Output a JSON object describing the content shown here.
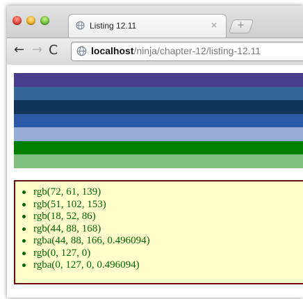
{
  "window": {
    "tab": {
      "title": "Listing 12.11",
      "close_glyph": "×"
    },
    "new_tab_glyph": "+",
    "toolbar": {
      "back_glyph": "←",
      "forward_glyph": "→",
      "reload_glyph": "C",
      "url_host": "localhost",
      "url_path": "/ninja/chapter-12/listing-12.11"
    }
  },
  "stripes": [
    {
      "color": "rgb(72, 61, 139)"
    },
    {
      "color": "rgb(51, 102, 153)"
    },
    {
      "color": "rgb(18, 52, 86)"
    },
    {
      "color": "rgb(44, 88, 168)"
    },
    {
      "color": "rgba(44, 88, 166, 0.496094)"
    },
    {
      "color": "rgb(0, 127, 0)"
    },
    {
      "color": "rgba(0, 127, 0, 0.496094)"
    }
  ],
  "color_list": [
    "rgb(72, 61, 139)",
    "rgb(51, 102, 153)",
    "rgb(18, 52, 86)",
    "rgb(44, 88, 168)",
    "rgba(44, 88, 166, 0.496094)",
    "rgb(0, 127, 0)",
    "rgba(0, 127, 0, 0.496094)"
  ],
  "icons": {
    "tab_favicon": "globe-icon",
    "omnibox": "globe-icon"
  },
  "colors": {
    "panel_background": "#ffffcc",
    "panel_border": "#6b1010",
    "list_text": "#006600"
  }
}
